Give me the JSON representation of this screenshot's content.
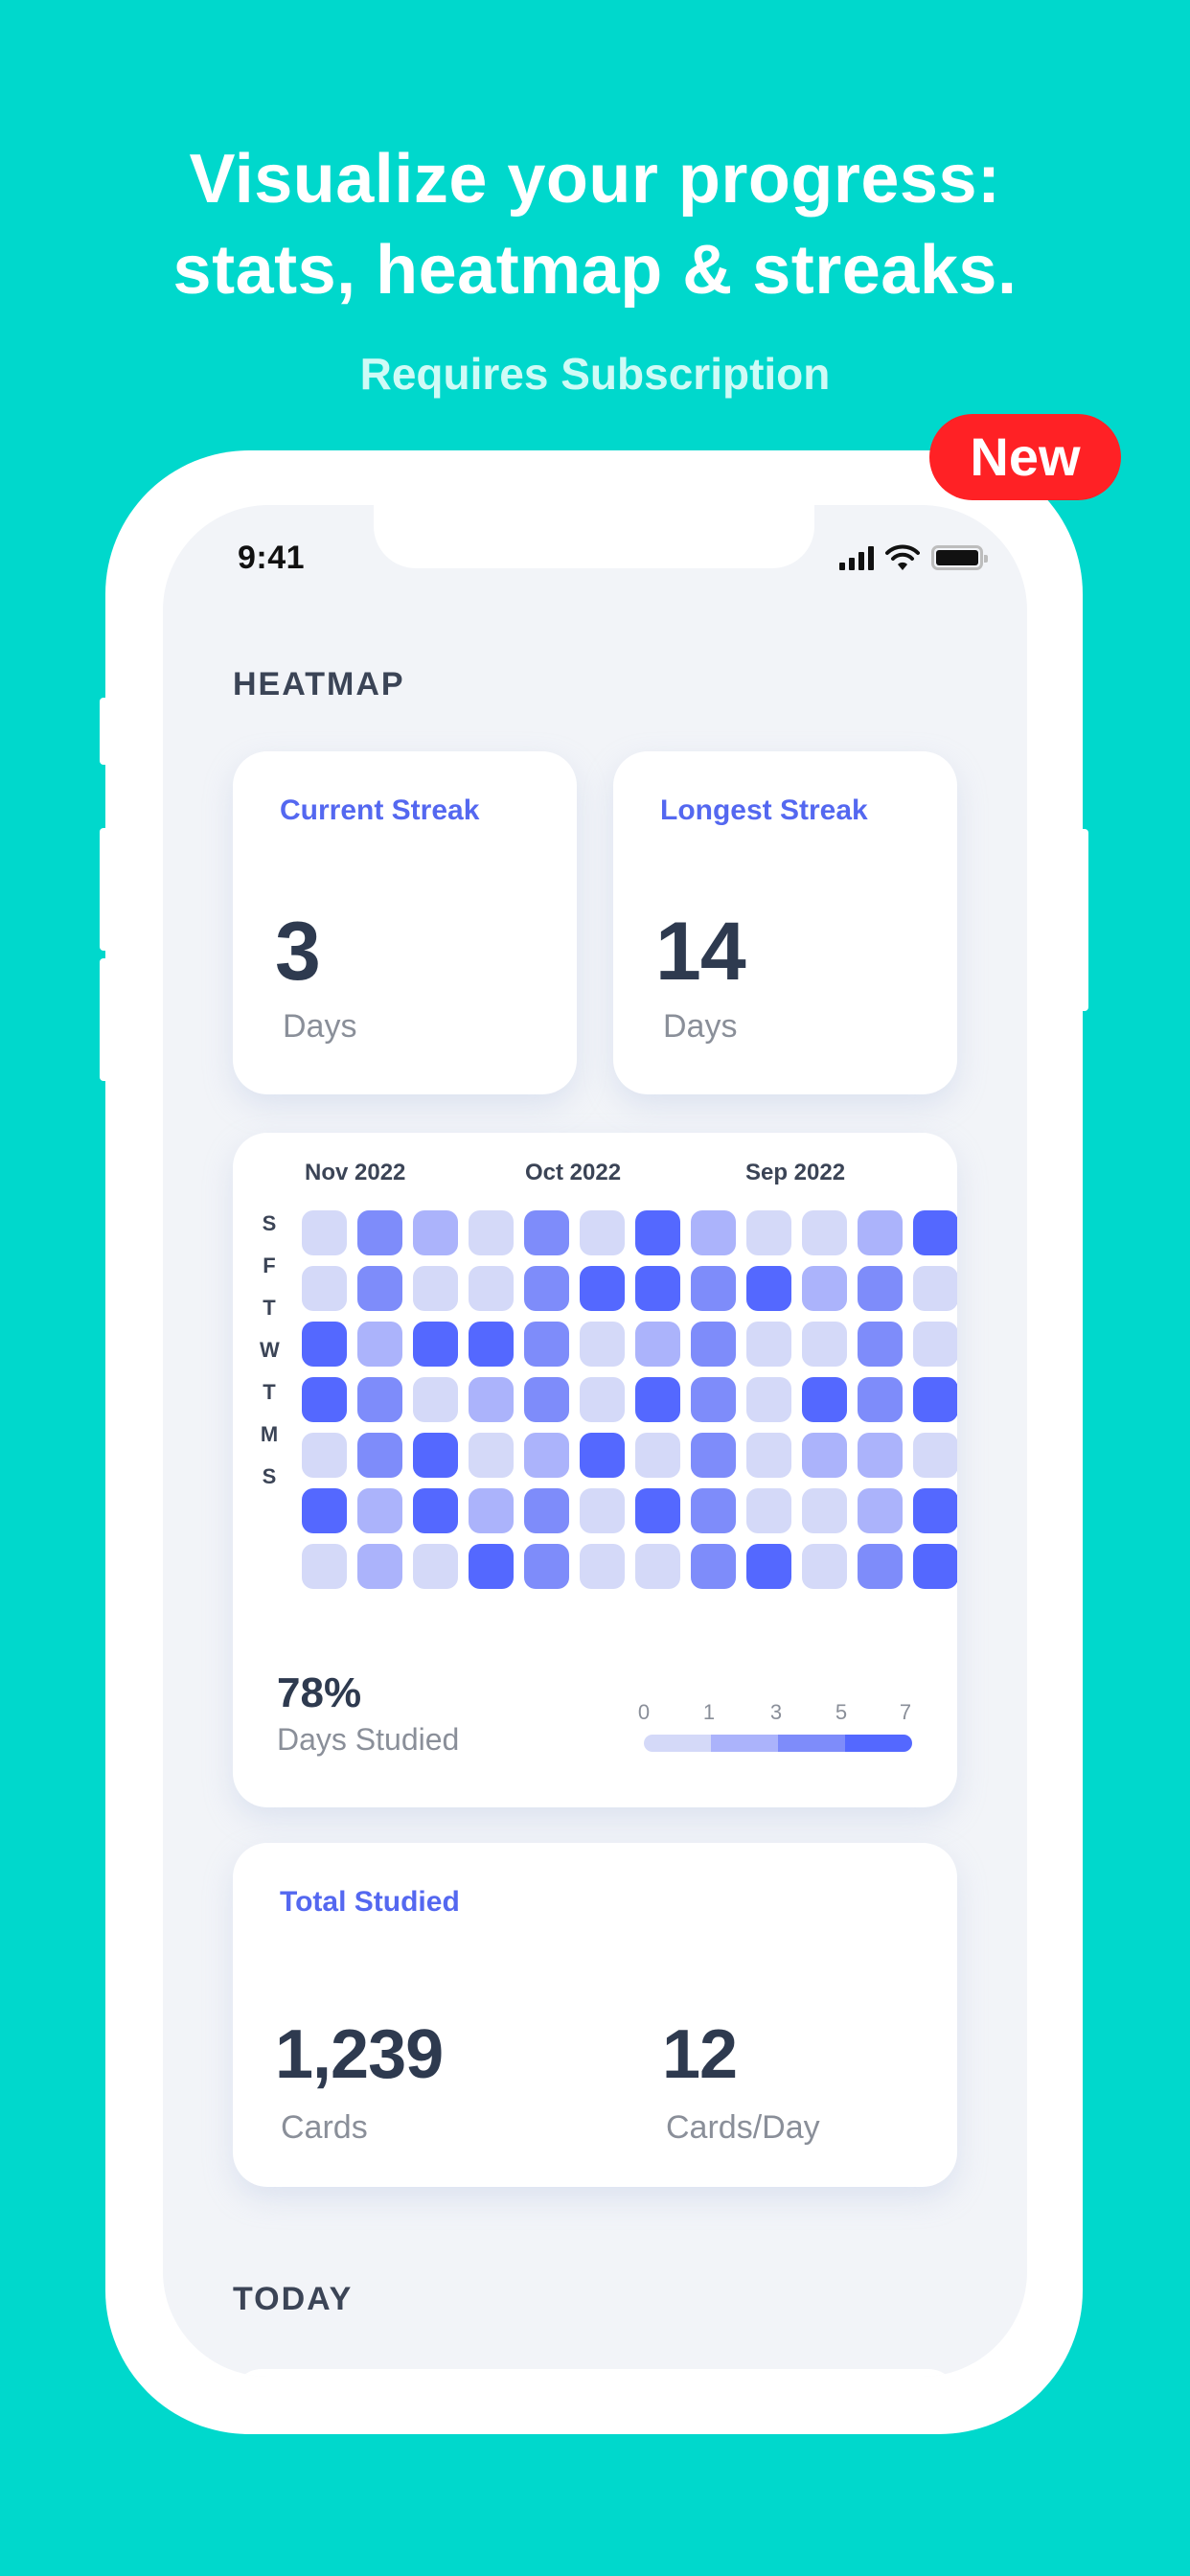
{
  "promo": {
    "headline_line1": "Visualize your progress:",
    "headline_line2": "stats, heatmap & streaks.",
    "subheadline": "Requires Subscription",
    "badge": "New",
    "colors": {
      "background": "#00D8CC",
      "badge": "#FF2125"
    }
  },
  "status_bar": {
    "time": "9:41",
    "icons": [
      "cellular-signal-icon",
      "wifi-icon",
      "battery-icon"
    ]
  },
  "heatmap_section": {
    "label": "HEATMAP",
    "current_streak": {
      "title": "Current Streak",
      "value": "3",
      "unit": "Days"
    },
    "longest_streak": {
      "title": "Longest Streak",
      "value": "14",
      "unit": "Days"
    },
    "months": [
      "Nov 2022",
      "Oct 2022",
      "Sep 2022"
    ],
    "day_labels": [
      "S",
      "F",
      "T",
      "W",
      "T",
      "M",
      "S"
    ],
    "days_studied_pct": "78%",
    "days_studied_label": "Days Studied",
    "legend": [
      "0",
      "1",
      "3",
      "5",
      "7"
    ],
    "level_colors": [
      "#D4D9F8",
      "#ABB3FB",
      "#7E8CFA",
      "#5468FF"
    ]
  },
  "total_studied": {
    "title": "Total Studied",
    "cards_value": "1,239",
    "cards_label": "Cards",
    "per_day_value": "12",
    "per_day_label": "Cards/Day"
  },
  "today_section": {
    "label": "TODAY"
  },
  "chart_data": {
    "type": "heatmap",
    "title": "",
    "x_labels": [
      "Nov 2022",
      "Oct 2022",
      "Sep 2022"
    ],
    "y_labels": [
      "S",
      "F",
      "T",
      "W",
      "T",
      "M",
      "S"
    ],
    "legend": [
      "0",
      "1",
      "3",
      "5",
      "7"
    ],
    "levels_description": "0 = 0-1, 1 = 1-3, 2 = 3-5, 3 = 5-7 (legend buckets)",
    "columns": 12,
    "rows": 7,
    "values": [
      [
        0,
        2,
        1,
        0,
        2,
        0,
        3,
        1,
        0,
        0,
        1,
        3
      ],
      [
        0,
        2,
        0,
        0,
        2,
        3,
        3,
        2,
        3,
        1,
        2,
        0
      ],
      [
        3,
        1,
        3,
        3,
        2,
        0,
        1,
        2,
        0,
        0,
        2,
        0
      ],
      [
        3,
        2,
        0,
        1,
        2,
        0,
        3,
        2,
        0,
        3,
        2,
        3
      ],
      [
        0,
        2,
        3,
        0,
        1,
        3,
        0,
        2,
        0,
        1,
        1,
        0
      ],
      [
        3,
        1,
        3,
        1,
        2,
        0,
        3,
        2,
        0,
        0,
        1,
        3
      ],
      [
        0,
        1,
        0,
        3,
        2,
        0,
        0,
        2,
        3,
        0,
        2,
        3
      ]
    ]
  }
}
